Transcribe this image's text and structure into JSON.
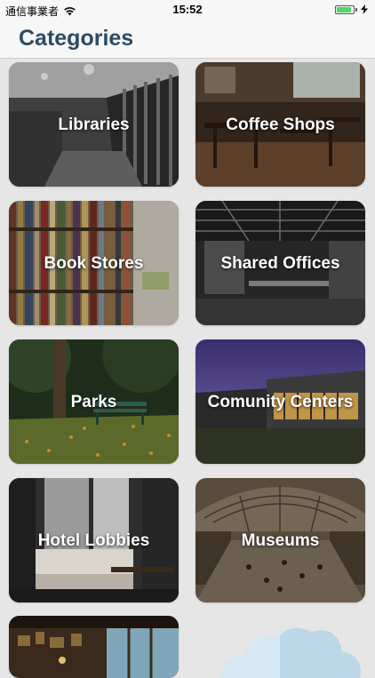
{
  "status": {
    "carrier": "通信事業者",
    "time": "15:52",
    "battery_level": 0.9,
    "battery_color": "#4cd964"
  },
  "nav": {
    "title": "Categories",
    "title_color": "#2d4a63"
  },
  "categories": [
    {
      "label": "Libraries"
    },
    {
      "label": "Coffee Shops"
    },
    {
      "label": "Book Stores"
    },
    {
      "label": "Shared Offices"
    },
    {
      "label": "Parks"
    },
    {
      "label": "Comunity Centers"
    },
    {
      "label": "Hotel Lobbies"
    },
    {
      "label": "Museums"
    }
  ]
}
